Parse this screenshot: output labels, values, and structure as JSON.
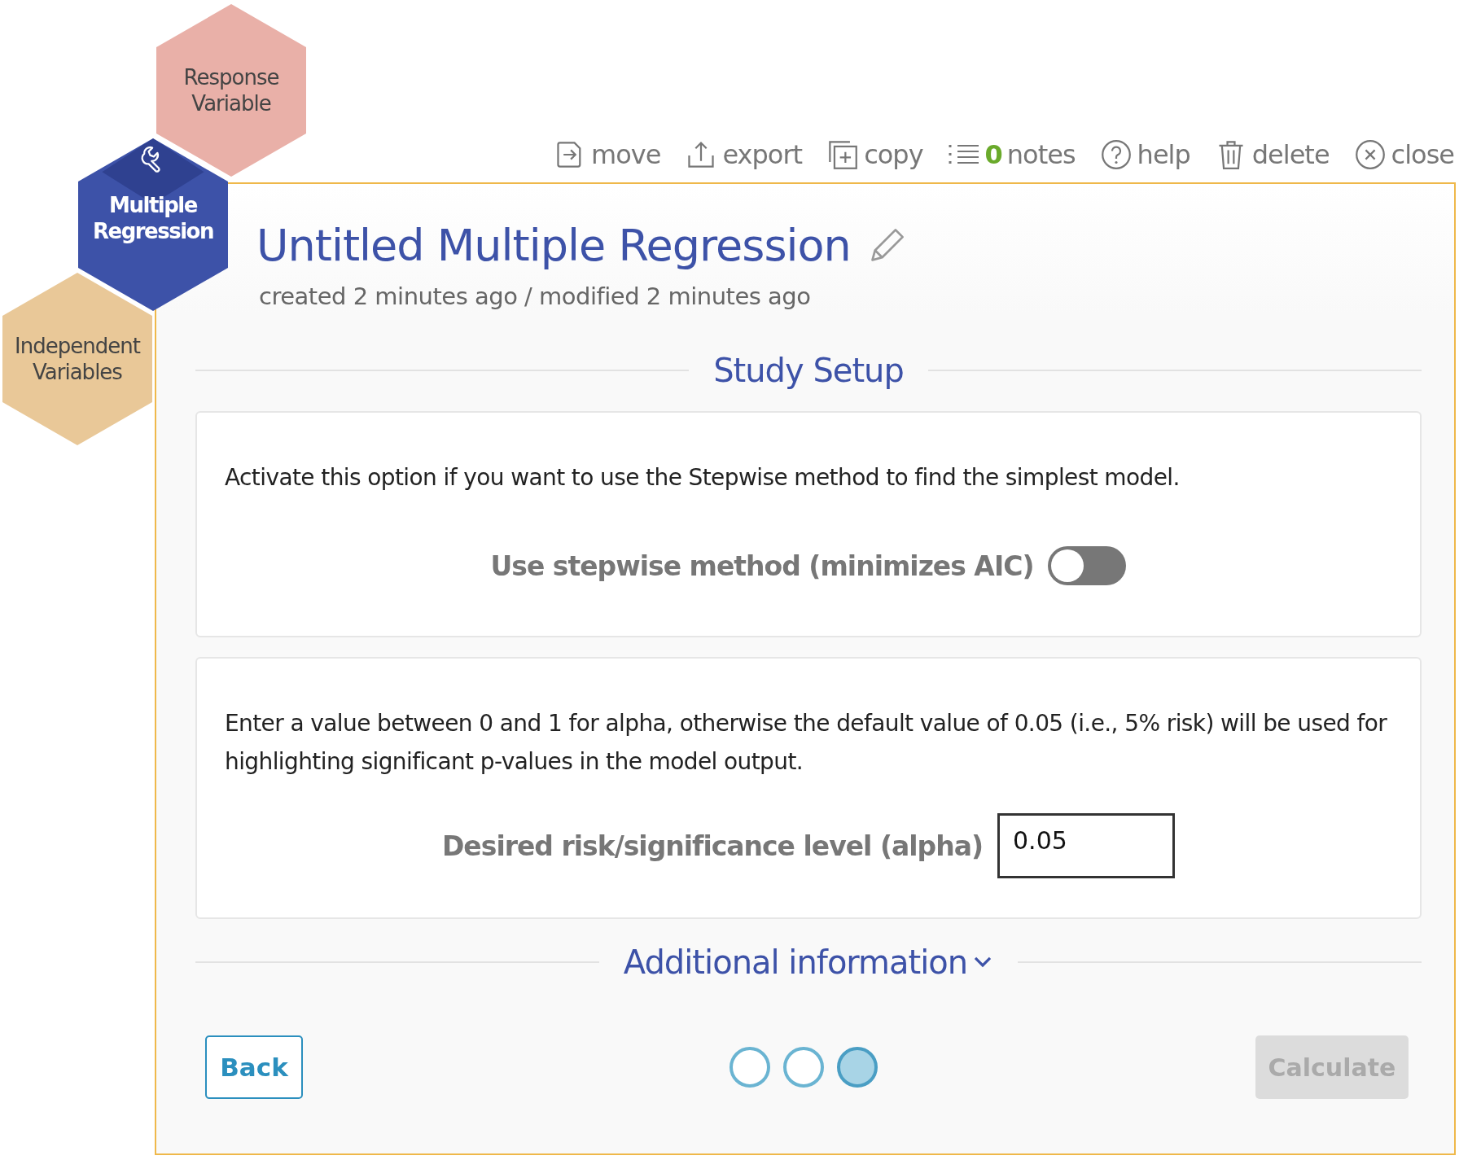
{
  "hexagons": [
    {
      "label": "Response Variable",
      "selected": false,
      "color": "#e9b0a8"
    },
    {
      "label": "Multiple Regression",
      "selected": true,
      "color": "#3d52a8"
    },
    {
      "label": "Independent Variables",
      "selected": false,
      "color": "#e9c898"
    }
  ],
  "toolbar": [
    {
      "kind": "move",
      "label": "move"
    },
    {
      "kind": "export",
      "label": "export"
    },
    {
      "kind": "copy",
      "label": "copy"
    },
    {
      "kind": "notes",
      "count": "0",
      "label": "notes"
    },
    {
      "kind": "help",
      "label": "help"
    },
    {
      "kind": "delete",
      "label": "delete"
    },
    {
      "kind": "close",
      "label": "close"
    }
  ],
  "title": "Untitled Multiple Regression",
  "subtitle": "created 2 minutes ago / modified 2 minutes ago",
  "section_title": "Study Setup",
  "cards": [
    {
      "kind": "toggle",
      "description": "Activate this option if you want to use the Stepwise method to find the simplest model.",
      "label": "Use stepwise method (minimizes AIC)",
      "on": false
    },
    {
      "kind": "input",
      "description": "Enter a value between 0 and 1 for alpha, otherwise the default value of 0.05 (i.e., 5% risk) will be used for highlighting significant p-values in the model output.",
      "label": "Desired risk/significance level (alpha)",
      "value": "0.05"
    }
  ],
  "additional_info": "Additional information",
  "back": "Back",
  "steps": [
    {
      "selected": false
    },
    {
      "selected": false
    },
    {
      "selected": true
    }
  ],
  "calculate": {
    "label": "Calculate",
    "disabled": true
  }
}
